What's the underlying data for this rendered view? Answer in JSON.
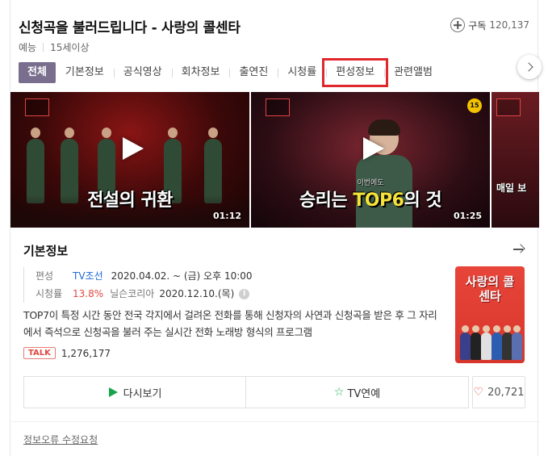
{
  "header": {
    "title": "신청곡을 불러드립니다 - 사랑의 콜센타",
    "genre": "예능",
    "rating": "15세이상",
    "subscribe_label": "구독",
    "subscribe_count": "120,137"
  },
  "tabs": [
    {
      "label": "전체",
      "active": true
    },
    {
      "label": "기본정보"
    },
    {
      "label": "공식영상"
    },
    {
      "label": "회차정보"
    },
    {
      "label": "출연진"
    },
    {
      "label": "시청률"
    },
    {
      "label": "편성정보",
      "highlighted": true
    },
    {
      "label": "관련앨범"
    }
  ],
  "videos": [
    {
      "caption_main": "전설",
      "caption_accent": "의 귀환",
      "duration": "01:12"
    },
    {
      "caption_top": "이번에도",
      "caption_main": "승리는 ",
      "caption_accent": "TOP6",
      "caption_end": "의 것",
      "duration": "01:25",
      "badge": "15"
    },
    {
      "caption_main": "매일 보"
    }
  ],
  "info": {
    "heading": "기본정보",
    "schedule_label": "편성",
    "channel": "TV조선",
    "schedule": "2020.04.02. ~ (금) 오후 10:00",
    "ratings_label": "시청률",
    "ratings_value": "13.8%",
    "ratings_source": "닐슨코리아",
    "ratings_date": "2020.12.10.(목)",
    "info_icon": "i",
    "description": "TOP7이 특정 시간 동안 전국 각지에서 걸려온 전화를 통해 신청자의 사연과 신청곡을 받은 후 그 자리에서 즉석으로 신청곡을 불러 주는 실시간 전화 노래방 형식의 프로그램",
    "poster_title": "사랑의 콜센타",
    "talk_badge": "TALK",
    "talk_count": "1,276,177"
  },
  "actions": {
    "watch_label": "다시보기",
    "tv_label": "TV연예",
    "like_count": "20,721"
  },
  "footer": {
    "report_label": "정보오류 수정요청"
  },
  "colors": {
    "active_tab": "#7a6e8f",
    "highlight": "#e0272c",
    "link": "#1f6ad8",
    "rating": "#e0493f",
    "green": "#18a34a"
  }
}
